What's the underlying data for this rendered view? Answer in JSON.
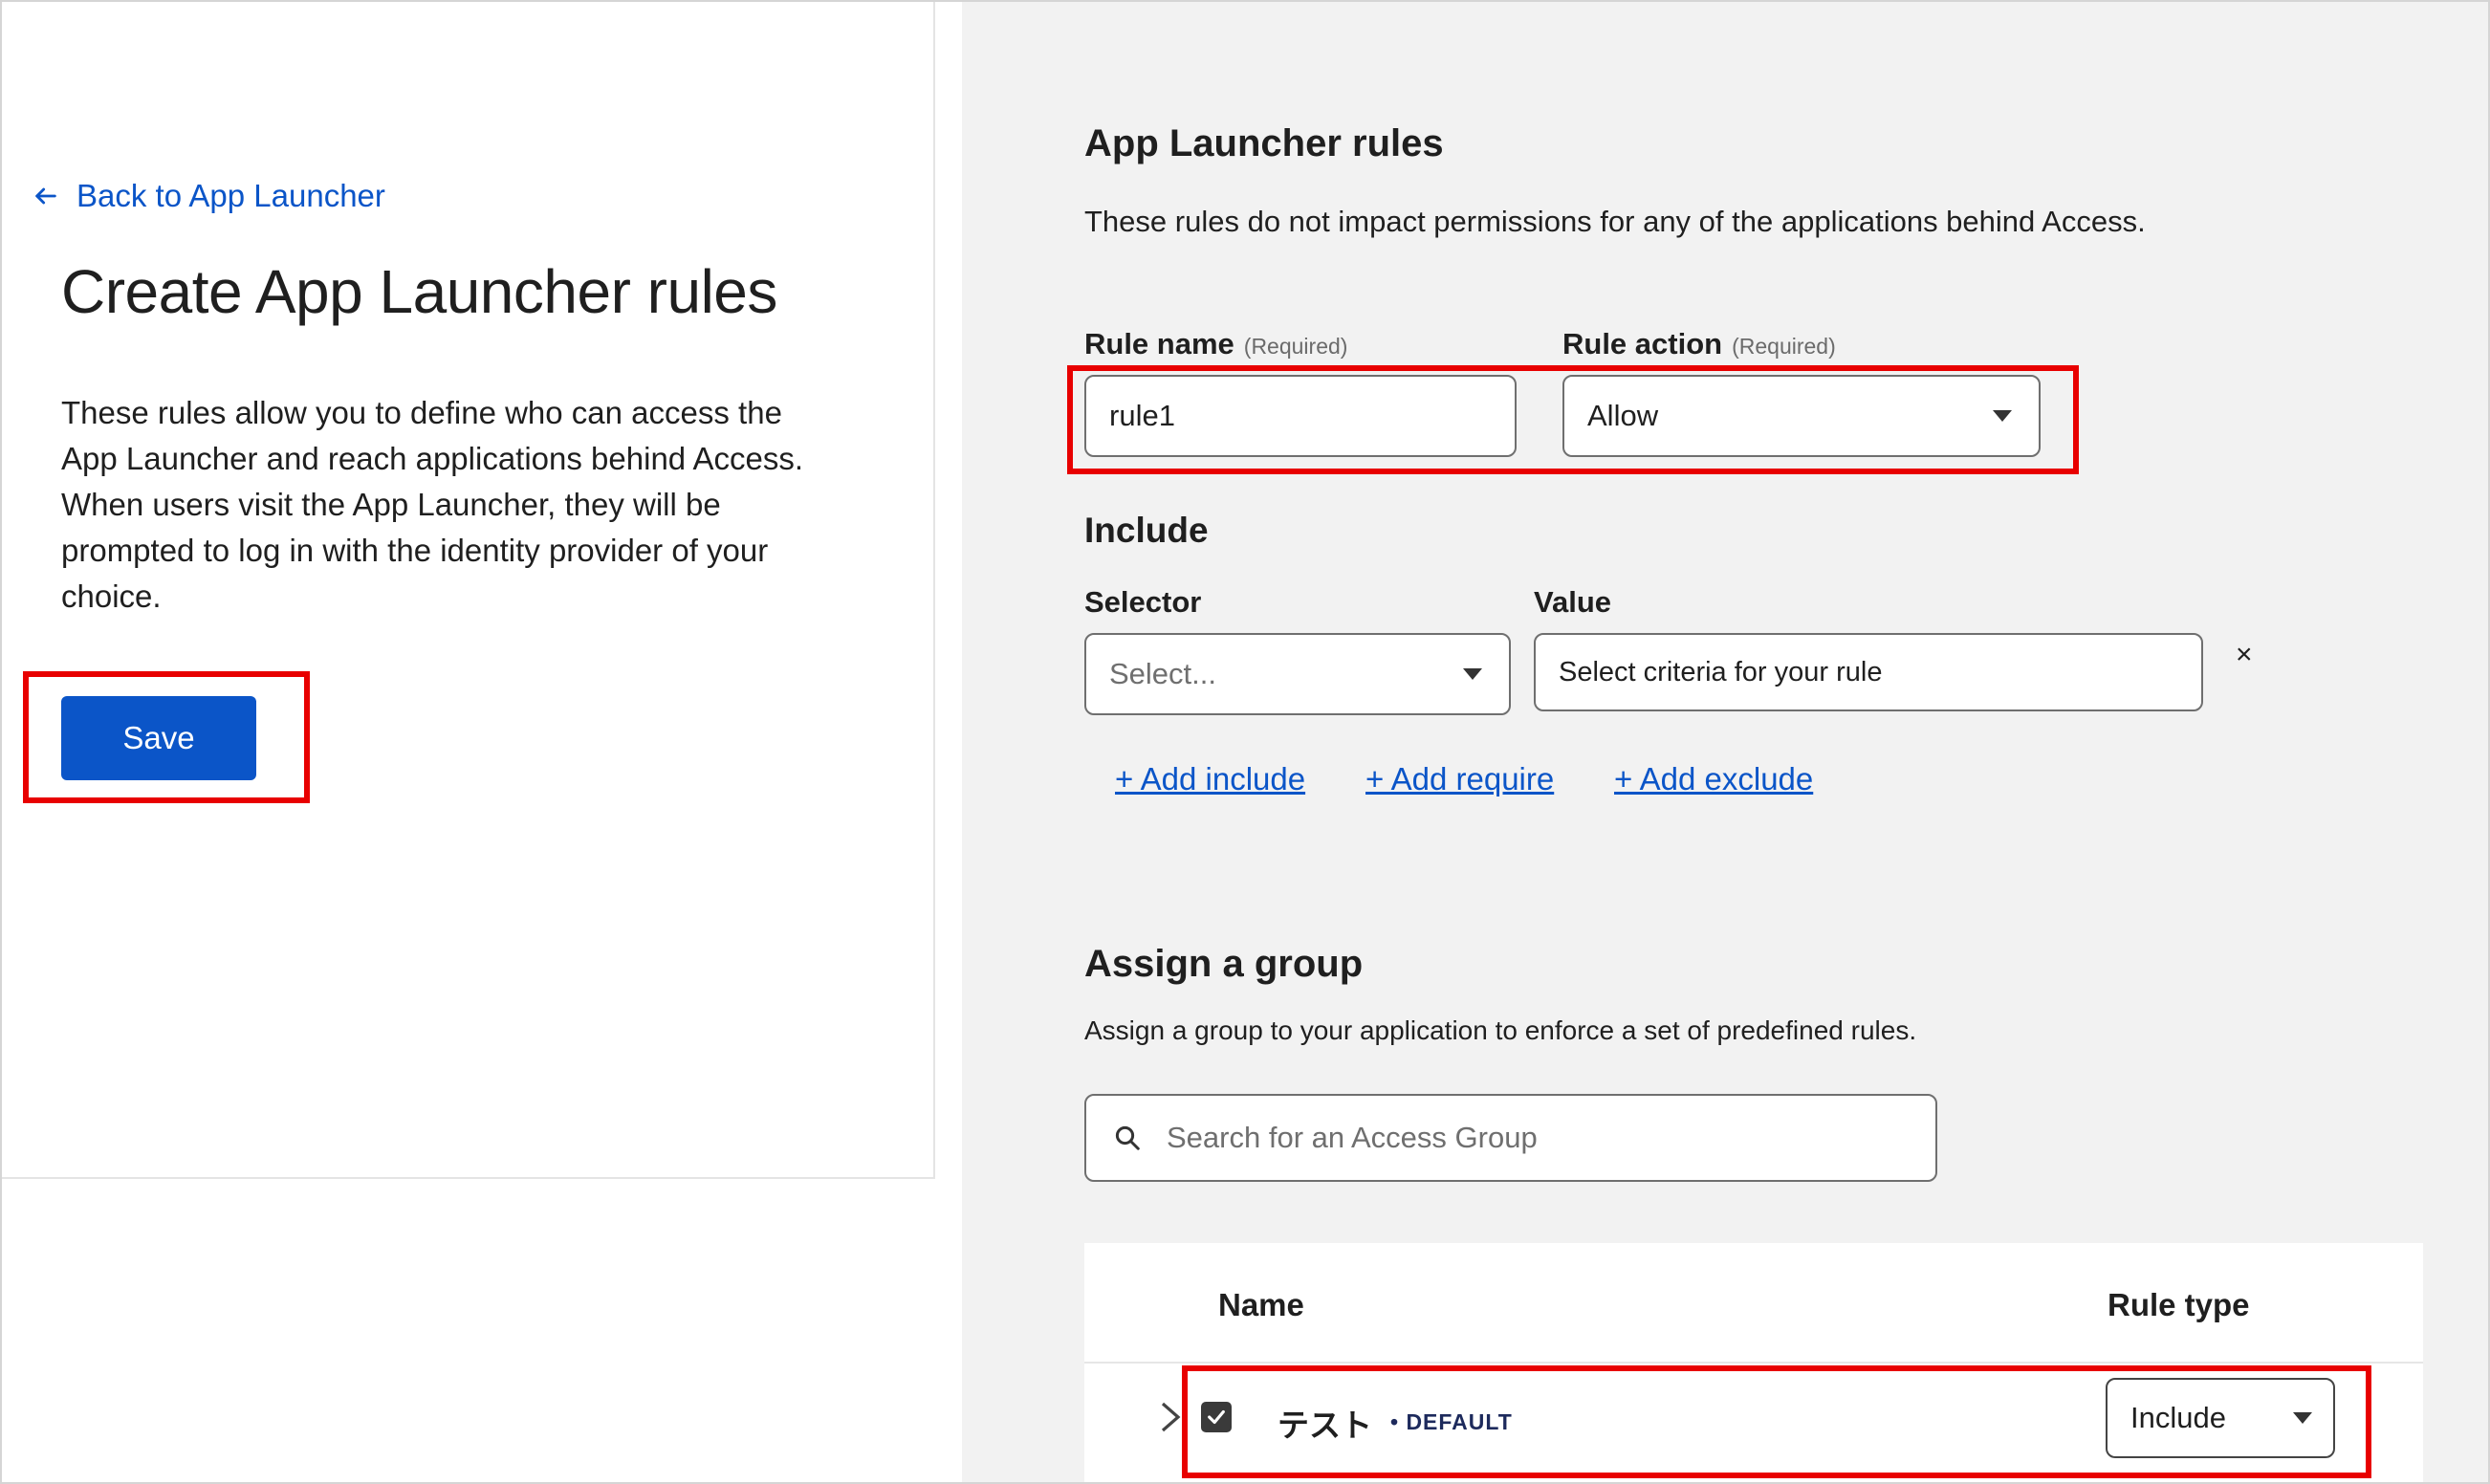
{
  "left": {
    "back_link": "Back to App Launcher",
    "title": "Create App Launcher rules",
    "description": "These rules allow you to define who can access the App Launcher and reach applications behind Access. When users visit the App Launcher, they will be prompted to log in with the identity provider of your choice.",
    "save_label": "Save"
  },
  "right": {
    "section_title": "App Launcher rules",
    "section_desc": "These rules do not impact permissions for any of the applications behind Access.",
    "rule_name": {
      "label": "Rule name",
      "required": "(Required)",
      "value": "rule1"
    },
    "rule_action": {
      "label": "Rule action",
      "required": "(Required)",
      "value": "Allow"
    },
    "include": {
      "title": "Include",
      "selector_label": "Selector",
      "selector_placeholder": "Select...",
      "value_label": "Value",
      "value_placeholder": "Select criteria for your rule",
      "remove_glyph": "×"
    },
    "links": {
      "add_include": "+ Add include",
      "add_require": "+ Add require",
      "add_exclude": "+ Add exclude"
    },
    "group": {
      "title": "Assign a group",
      "desc": "Assign a group to your application to enforce a set of predefined rules.",
      "search_placeholder": "Search for an Access Group"
    },
    "table": {
      "col_name": "Name",
      "col_rule_type": "Rule type",
      "rows": [
        {
          "name": "テスト",
          "badge": "• DEFAULT",
          "rule_type": "Include",
          "checked": true
        }
      ]
    }
  },
  "colors": {
    "accent": "#0b55c8",
    "highlight": "#e80000",
    "panel_bg": "#f2f2f2"
  }
}
